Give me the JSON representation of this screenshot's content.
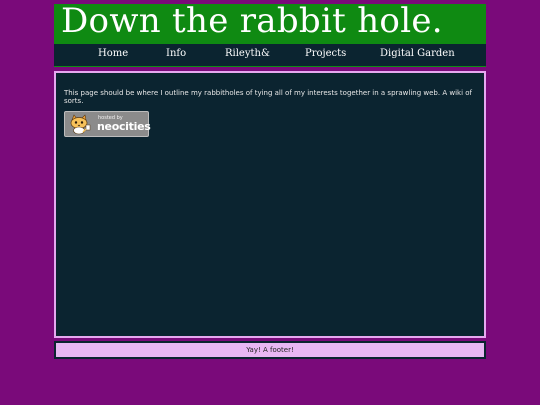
{
  "header": {
    "title": "Down the rabbit hole."
  },
  "nav": {
    "items": [
      {
        "label": "Home"
      },
      {
        "label": "Info"
      },
      {
        "label": "Rileyth&"
      },
      {
        "label": "Projects"
      },
      {
        "label": "Digital Garden"
      }
    ]
  },
  "main": {
    "text": "This page should be where I outline my rabbitholes of tying all of my interests together in a sprawling web. A wiki of sorts."
  },
  "badge": {
    "hosted_by": "hosted by",
    "name": "neocities",
    "icon": "neocities-cat-icon"
  },
  "footer": {
    "text": "Yay! A footer!"
  },
  "colors": {
    "page_bg": "#7a0a7a",
    "banner_bg": "#0f8a12",
    "panel_bg": "#0b2430",
    "panel_border": "#e6a8f0",
    "footer_bg": "#e8b7f3"
  }
}
